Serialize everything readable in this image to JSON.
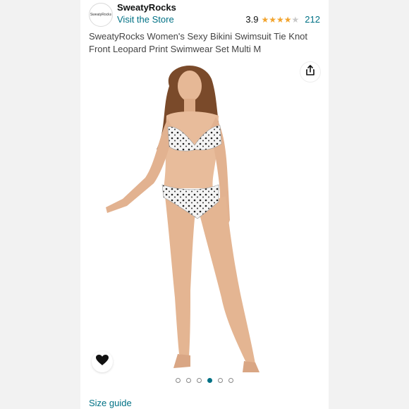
{
  "store": {
    "logo_text": "SweatyRocks",
    "name": "SweatyRocks",
    "visit_label": "Visit the Store"
  },
  "rating": {
    "value": "3.9",
    "stars": 3.9,
    "count": "212",
    "star_color": "#F2A42E"
  },
  "product": {
    "title": "SweatyRocks Women's Sexy Bikini Swimsuit Tie Knot Front Leopard Print Swimwear Set Multi M"
  },
  "gallery": {
    "total_images": 6,
    "active_index": 3,
    "share_icon": "share-icon",
    "favorite_icon": "heart-icon"
  },
  "size_guide": {
    "label": "Size guide"
  },
  "colors": {
    "link": "#007185",
    "text": "#0F1111"
  }
}
